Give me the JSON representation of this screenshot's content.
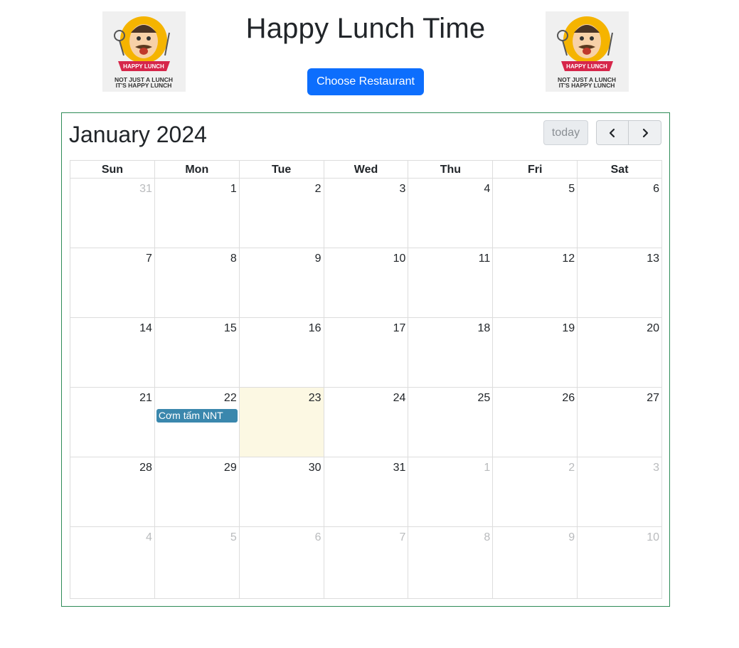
{
  "header": {
    "title": "Happy Lunch Time",
    "choose_button": "Choose Restaurant",
    "logo": {
      "banner": "HAPPY LUNCH",
      "tagline_line1": "NOT JUST A LUNCH",
      "tagline_line2": "IT'S HAPPY LUNCH"
    }
  },
  "calendar": {
    "title": "January 2024",
    "today_button": "today",
    "prev_icon": "chevron-left-icon",
    "next_icon": "chevron-right-icon",
    "weekdays": [
      "Sun",
      "Mon",
      "Tue",
      "Wed",
      "Thu",
      "Fri",
      "Sat"
    ],
    "weeks": [
      [
        {
          "d": "31",
          "other": true
        },
        {
          "d": "1"
        },
        {
          "d": "2"
        },
        {
          "d": "3"
        },
        {
          "d": "4"
        },
        {
          "d": "5"
        },
        {
          "d": "6"
        }
      ],
      [
        {
          "d": "7"
        },
        {
          "d": "8"
        },
        {
          "d": "9"
        },
        {
          "d": "10"
        },
        {
          "d": "11"
        },
        {
          "d": "12"
        },
        {
          "d": "13"
        }
      ],
      [
        {
          "d": "14"
        },
        {
          "d": "15"
        },
        {
          "d": "16"
        },
        {
          "d": "17"
        },
        {
          "d": "18"
        },
        {
          "d": "19"
        },
        {
          "d": "20"
        }
      ],
      [
        {
          "d": "21"
        },
        {
          "d": "22",
          "event": "Cơm tấm NNT"
        },
        {
          "d": "23",
          "today": true
        },
        {
          "d": "24"
        },
        {
          "d": "25"
        },
        {
          "d": "26"
        },
        {
          "d": "27"
        }
      ],
      [
        {
          "d": "28"
        },
        {
          "d": "29"
        },
        {
          "d": "30"
        },
        {
          "d": "31"
        },
        {
          "d": "1",
          "other": true
        },
        {
          "d": "2",
          "other": true
        },
        {
          "d": "3",
          "other": true
        }
      ],
      [
        {
          "d": "4",
          "other": true
        },
        {
          "d": "5",
          "other": true
        },
        {
          "d": "6",
          "other": true
        },
        {
          "d": "7",
          "other": true
        },
        {
          "d": "8",
          "other": true
        },
        {
          "d": "9",
          "other": true
        },
        {
          "d": "10",
          "other": true
        }
      ]
    ],
    "colors": {
      "today_bg": "#fcf8e3",
      "event_bg": "#3a87ad",
      "border": "#2e8b57"
    }
  }
}
